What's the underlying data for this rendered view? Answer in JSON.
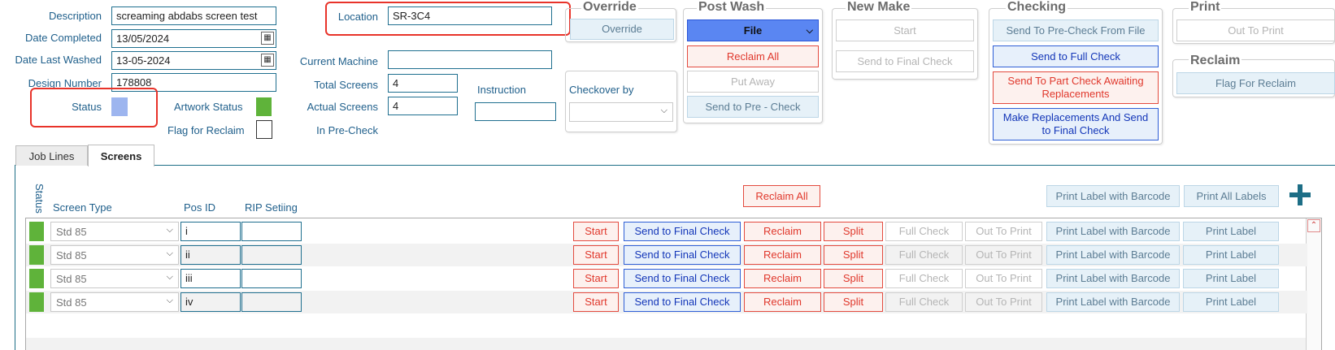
{
  "form": {
    "description_label": "Description",
    "description_value": "screaming abdabs screen test",
    "date_completed_label": "Date Completed",
    "date_completed_value": "13/05/2024",
    "date_last_washed_label": "Date Last Washed",
    "date_last_washed_value": "13-05-2024",
    "design_number_label": "Design Number",
    "design_number_value": "178808",
    "status_label": "Status",
    "artwork_status_label": "Artwork Status",
    "flag_for_reclaim_label": "Flag for Reclaim",
    "location_label": "Location",
    "location_value": "SR-3C4",
    "current_machine_label": "Current Machine",
    "current_machine_value": "",
    "total_screens_label": "Total Screens",
    "total_screens_value": "4",
    "actual_screens_label": "Actual Screens",
    "actual_screens_value": "4",
    "in_precheck_label": "In Pre-Check",
    "instruction_label": "Instruction",
    "instruction_value": "",
    "checkover_label": "Checkover by",
    "checkover_value": ""
  },
  "groups": {
    "override": {
      "title": "Override",
      "override_btn": "Override"
    },
    "post_wash": {
      "title": "Post Wash",
      "file_select": "File",
      "reclaim_all": "Reclaim All",
      "put_away": "Put Away",
      "send_pre_check": "Send to Pre - Check"
    },
    "new_make": {
      "title": "New Make",
      "start": "Start",
      "send_final": "Send to Final Check"
    },
    "checking": {
      "title": "Checking",
      "send_pre_from_file": "Send To Pre-Check From File",
      "send_full": "Send to Full Check",
      "send_part": "Send To Part Check Awaiting Replacements",
      "make_replacements": "Make Replacements And Send to Final Check"
    },
    "print": {
      "title": "Print",
      "out_to_print": "Out To Print"
    },
    "reclaim": {
      "title": "Reclaim",
      "flag_for_reclaim": "Flag For Reclaim"
    }
  },
  "tabs": [
    {
      "label": "Job Lines"
    },
    {
      "label": "Screens"
    }
  ],
  "screens": {
    "status_header": "Status",
    "screen_type_header": "Screen Type",
    "pos_id_header": "Pos ID",
    "rip_header": "RIP Setiing",
    "reclaim_all": "Reclaim All",
    "print_label_barcode": "Print Label with Barcode",
    "print_all_labels": "Print All Labels",
    "add_icon": "plus-icon",
    "row_buttons": {
      "start": "Start",
      "send_final": "Send to Final Check",
      "reclaim": "Reclaim",
      "split": "Split",
      "full_check": "Full Check",
      "out_to_print": "Out To Print",
      "print_barcode": "Print Label with Barcode",
      "print_label": "Print Label"
    },
    "rows": [
      {
        "screen_type": "Std 85",
        "pos_id": "i",
        "rip": ""
      },
      {
        "screen_type": "Std 85",
        "pos_id": "ii",
        "rip": ""
      },
      {
        "screen_type": "Std 85",
        "pos_id": "iii",
        "rip": ""
      },
      {
        "screen_type": "Std 85",
        "pos_id": "iv",
        "rip": ""
      }
    ]
  },
  "colors": {
    "label": "#1f5f8b",
    "status_green": "#5fb33a",
    "status_blue": "#9db5ef",
    "highlight_red": "#e8332a",
    "accent_teal": "#1d6e86"
  }
}
